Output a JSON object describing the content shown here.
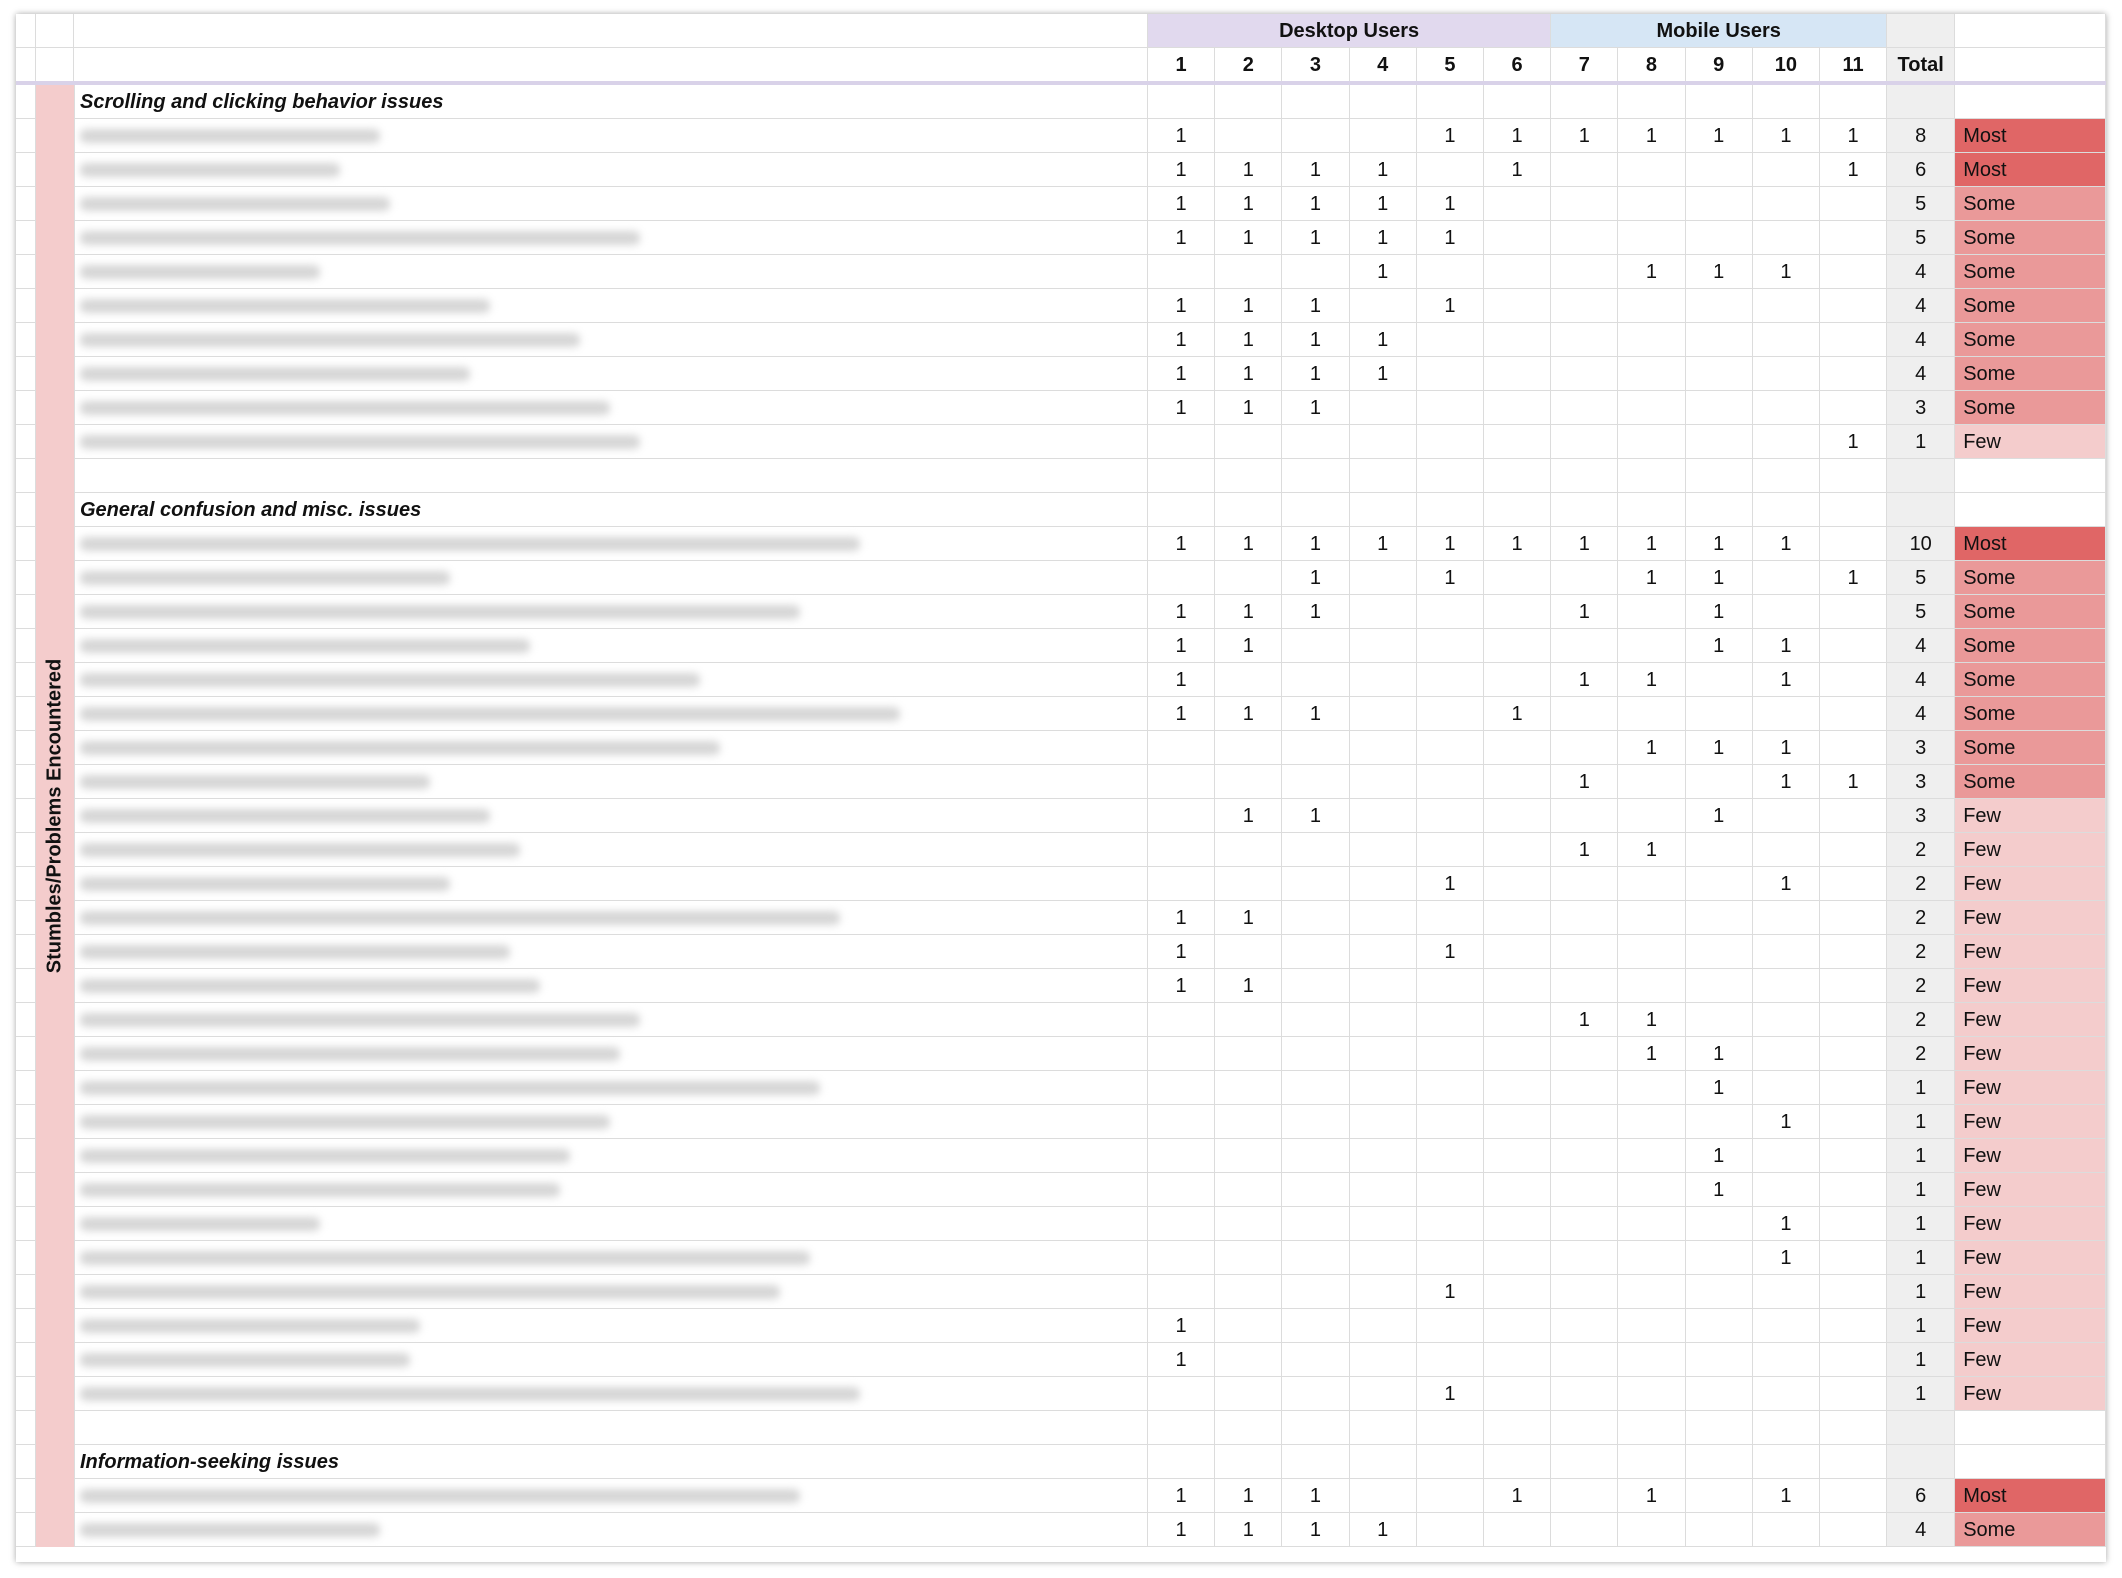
{
  "header": {
    "groups": [
      {
        "label": "Desktop Users",
        "span": [
          1,
          6
        ],
        "color": "#e1d9ee"
      },
      {
        "label": "Mobile Users",
        "span": [
          7,
          11
        ],
        "color": "#d6e6f5"
      }
    ],
    "user_columns": [
      "1",
      "2",
      "3",
      "4",
      "5",
      "6",
      "7",
      "8",
      "9",
      "10",
      "11"
    ],
    "total_label": "Total"
  },
  "side_label": "Stumbles/Problems Encountered",
  "frequency_colors": {
    "Most": "#e06666",
    "Some": "#ea9999",
    "Few": "#f4cccc"
  },
  "sections": [
    {
      "title": "Scrolling and clicking behavior issues",
      "rows": [
        {
          "marks": [
            1,
            0,
            0,
            0,
            1,
            1,
            1,
            1,
            1,
            1,
            1
          ],
          "total": "8",
          "freq": "Most"
        },
        {
          "marks": [
            1,
            1,
            1,
            1,
            0,
            1,
            0,
            0,
            0,
            0,
            1
          ],
          "total": "6",
          "freq": "Most"
        },
        {
          "marks": [
            1,
            1,
            1,
            1,
            1,
            0,
            0,
            0,
            0,
            0,
            0
          ],
          "total": "5",
          "freq": "Some"
        },
        {
          "marks": [
            1,
            1,
            1,
            1,
            1,
            0,
            0,
            0,
            0,
            0,
            0
          ],
          "total": "5",
          "freq": "Some"
        },
        {
          "marks": [
            0,
            0,
            0,
            1,
            0,
            0,
            0,
            1,
            1,
            1,
            0
          ],
          "total": "4",
          "freq": "Some"
        },
        {
          "marks": [
            1,
            1,
            1,
            0,
            1,
            0,
            0,
            0,
            0,
            0,
            0
          ],
          "total": "4",
          "freq": "Some"
        },
        {
          "marks": [
            1,
            1,
            1,
            1,
            0,
            0,
            0,
            0,
            0,
            0,
            0
          ],
          "total": "4",
          "freq": "Some"
        },
        {
          "marks": [
            1,
            1,
            1,
            1,
            0,
            0,
            0,
            0,
            0,
            0,
            0
          ],
          "total": "4",
          "freq": "Some"
        },
        {
          "marks": [
            1,
            1,
            1,
            0,
            0,
            0,
            0,
            0,
            0,
            0,
            0
          ],
          "total": "3",
          "freq": "Some"
        },
        {
          "marks": [
            0,
            0,
            0,
            0,
            0,
            0,
            0,
            0,
            0,
            0,
            1
          ],
          "total": "1",
          "freq": "Few"
        }
      ]
    },
    {
      "title": "General confusion and misc. issues",
      "rows": [
        {
          "marks": [
            1,
            1,
            1,
            1,
            1,
            1,
            1,
            1,
            1,
            1,
            0
          ],
          "total": "10",
          "freq": "Most"
        },
        {
          "marks": [
            0,
            0,
            1,
            0,
            1,
            0,
            0,
            1,
            1,
            0,
            1
          ],
          "total": "5",
          "freq": "Some"
        },
        {
          "marks": [
            1,
            1,
            1,
            0,
            0,
            0,
            1,
            0,
            1,
            0,
            0
          ],
          "total": "5",
          "freq": "Some"
        },
        {
          "marks": [
            1,
            1,
            0,
            0,
            0,
            0,
            0,
            0,
            1,
            1,
            0
          ],
          "total": "4",
          "freq": "Some"
        },
        {
          "marks": [
            1,
            0,
            0,
            0,
            0,
            0,
            1,
            1,
            0,
            1,
            0
          ],
          "total": "4",
          "freq": "Some"
        },
        {
          "marks": [
            1,
            1,
            1,
            0,
            0,
            1,
            0,
            0,
            0,
            0,
            0
          ],
          "total": "4",
          "freq": "Some"
        },
        {
          "marks": [
            0,
            0,
            0,
            0,
            0,
            0,
            0,
            1,
            1,
            1,
            0
          ],
          "total": "3",
          "freq": "Some"
        },
        {
          "marks": [
            0,
            0,
            0,
            0,
            0,
            0,
            1,
            0,
            0,
            1,
            1
          ],
          "total": "3",
          "freq": "Some"
        },
        {
          "marks": [
            0,
            1,
            1,
            0,
            0,
            0,
            0,
            0,
            1,
            0,
            0
          ],
          "total": "3",
          "freq": "Few"
        },
        {
          "marks": [
            0,
            0,
            0,
            0,
            0,
            0,
            1,
            1,
            0,
            0,
            0
          ],
          "total": "2",
          "freq": "Few"
        },
        {
          "marks": [
            0,
            0,
            0,
            0,
            1,
            0,
            0,
            0,
            0,
            1,
            0
          ],
          "total": "2",
          "freq": "Few"
        },
        {
          "marks": [
            1,
            1,
            0,
            0,
            0,
            0,
            0,
            0,
            0,
            0,
            0
          ],
          "total": "2",
          "freq": "Few"
        },
        {
          "marks": [
            1,
            0,
            0,
            0,
            1,
            0,
            0,
            0,
            0,
            0,
            0
          ],
          "total": "2",
          "freq": "Few"
        },
        {
          "marks": [
            1,
            1,
            0,
            0,
            0,
            0,
            0,
            0,
            0,
            0,
            0
          ],
          "total": "2",
          "freq": "Few"
        },
        {
          "marks": [
            0,
            0,
            0,
            0,
            0,
            0,
            1,
            1,
            0,
            0,
            0
          ],
          "total": "2",
          "freq": "Few"
        },
        {
          "marks": [
            0,
            0,
            0,
            0,
            0,
            0,
            0,
            1,
            1,
            0,
            0
          ],
          "total": "2",
          "freq": "Few"
        },
        {
          "marks": [
            0,
            0,
            0,
            0,
            0,
            0,
            0,
            0,
            1,
            0,
            0
          ],
          "total": "1",
          "freq": "Few"
        },
        {
          "marks": [
            0,
            0,
            0,
            0,
            0,
            0,
            0,
            0,
            0,
            1,
            0
          ],
          "total": "1",
          "freq": "Few"
        },
        {
          "marks": [
            0,
            0,
            0,
            0,
            0,
            0,
            0,
            0,
            1,
            0,
            0
          ],
          "total": "1",
          "freq": "Few"
        },
        {
          "marks": [
            0,
            0,
            0,
            0,
            0,
            0,
            0,
            0,
            1,
            0,
            0
          ],
          "total": "1",
          "freq": "Few"
        },
        {
          "marks": [
            0,
            0,
            0,
            0,
            0,
            0,
            0,
            0,
            0,
            1,
            0
          ],
          "total": "1",
          "freq": "Few"
        },
        {
          "marks": [
            0,
            0,
            0,
            0,
            0,
            0,
            0,
            0,
            0,
            1,
            0
          ],
          "total": "1",
          "freq": "Few"
        },
        {
          "marks": [
            0,
            0,
            0,
            0,
            1,
            0,
            0,
            0,
            0,
            0,
            0
          ],
          "total": "1",
          "freq": "Few"
        },
        {
          "marks": [
            1,
            0,
            0,
            0,
            0,
            0,
            0,
            0,
            0,
            0,
            0
          ],
          "total": "1",
          "freq": "Few"
        },
        {
          "marks": [
            1,
            0,
            0,
            0,
            0,
            0,
            0,
            0,
            0,
            0,
            0
          ],
          "total": "1",
          "freq": "Few"
        },
        {
          "marks": [
            0,
            0,
            0,
            0,
            1,
            0,
            0,
            0,
            0,
            0,
            0
          ],
          "total": "1",
          "freq": "Few"
        }
      ]
    },
    {
      "title": "Information-seeking issues",
      "rows": [
        {
          "marks": [
            1,
            1,
            1,
            0,
            0,
            1,
            0,
            1,
            0,
            1,
            0
          ],
          "total": "6",
          "freq": "Most"
        },
        {
          "marks": [
            1,
            1,
            1,
            1,
            0,
            0,
            0,
            0,
            0,
            0,
            0
          ],
          "total": "4",
          "freq": "Some"
        }
      ]
    }
  ]
}
